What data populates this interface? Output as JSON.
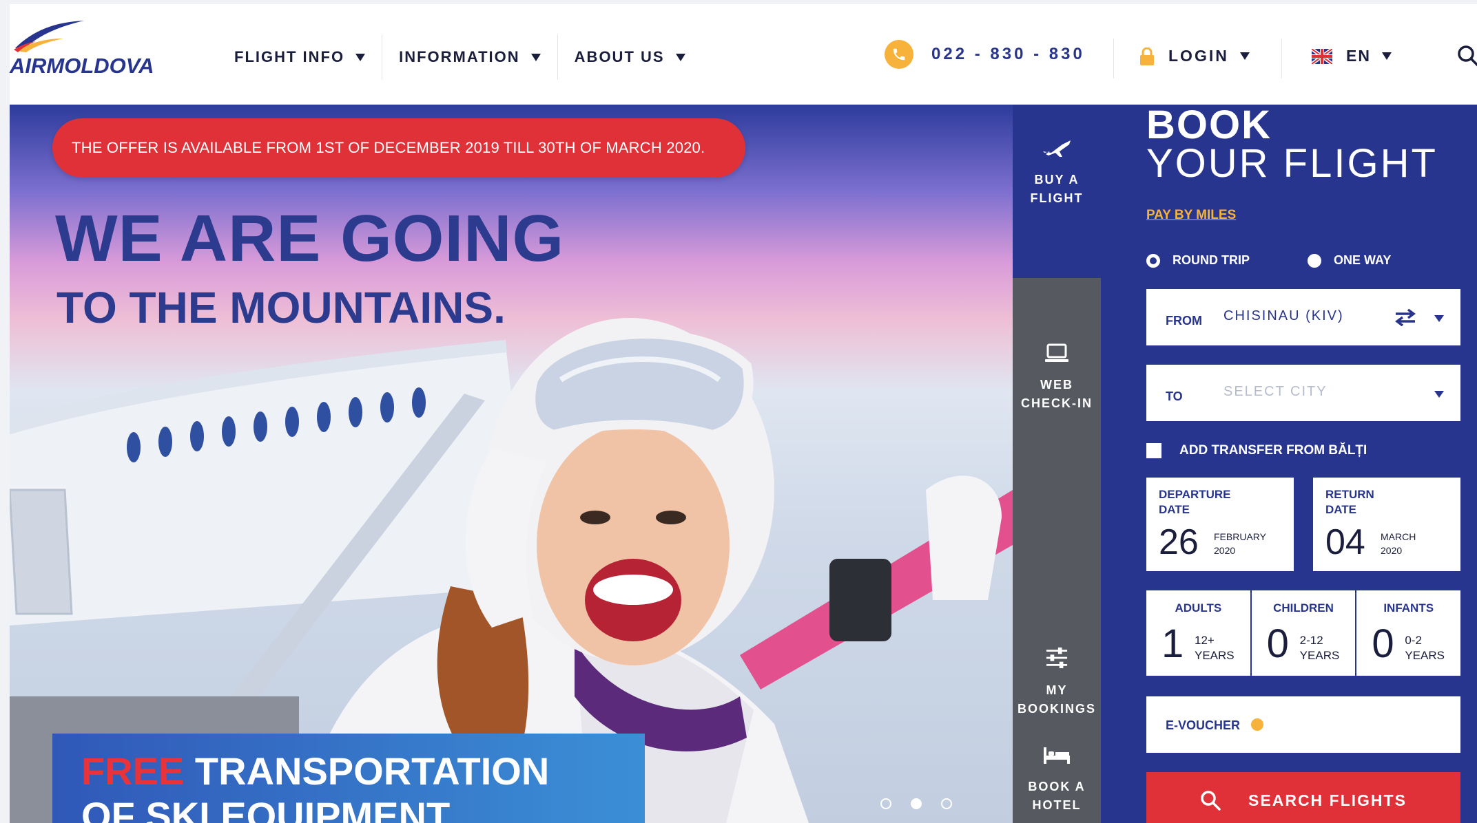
{
  "brand": {
    "name": "AIRMOLDOVA"
  },
  "nav": {
    "items": [
      {
        "label": "FLIGHT INFO"
      },
      {
        "label": "INFORMATION"
      },
      {
        "label": "ABOUT US"
      }
    ]
  },
  "header": {
    "phone": "022 - 830 - 830",
    "login_label": "LOGIN",
    "language": "EN"
  },
  "hero": {
    "offer": "THE OFFER IS AVAILABLE FROM 1ST OF DECEMBER 2019 TILL 30TH OF MARCH 2020.",
    "headline_1": "WE ARE GOING",
    "headline_2": "TO THE MOUNTAINS.",
    "promo_red": "FREE",
    "promo_rest": " TRANSPORTATION",
    "promo_line2": "OF SKI EQUIPMENT",
    "slides": 3,
    "active_slide": 2
  },
  "tabs": [
    {
      "label": "BUY A\nFLIGHT",
      "icon": "plane-icon"
    },
    {
      "label": "WEB\nCHECK-IN",
      "icon": "laptop-icon"
    },
    {
      "label": "MY\nBOOKINGS",
      "icon": "sliders-icon"
    },
    {
      "label": "BOOK A\nHOTEL",
      "icon": "bed-icon"
    }
  ],
  "booking": {
    "title_bold": "BOOK",
    "title_light": "YOUR FLIGHT",
    "pay_by_miles": "PAY BY MILES",
    "trip_types": [
      {
        "label": "ROUND TRIP",
        "selected": true
      },
      {
        "label": "ONE WAY",
        "selected": false
      }
    ],
    "from_label": "FROM",
    "from_value": "CHISINAU (KIV)",
    "to_label": "TO",
    "to_placeholder": "SELECT CITY",
    "transfer_label": "ADD TRANSFER FROM BĂLȚI",
    "transfer_checked": false,
    "departure": {
      "title": "DEPARTURE\nDATE",
      "day": "26",
      "month": "FEBRUARY",
      "year": "2020"
    },
    "return": {
      "title": "RETURN\nDATE",
      "day": "04",
      "month": "MARCH",
      "year": "2020"
    },
    "passengers": [
      {
        "title": "ADULTS",
        "count": "1",
        "age": "12+",
        "unit": "YEARS"
      },
      {
        "title": "CHILDREN",
        "count": "0",
        "age": "2-12",
        "unit": "YEARS"
      },
      {
        "title": "INFANTS",
        "count": "0",
        "age": "0-2",
        "unit": "YEARS"
      }
    ],
    "voucher_label": "E-VOUCHER",
    "search_label": "SEARCH FLIGHTS"
  },
  "colors": {
    "brand_blue": "#27358f",
    "accent_red": "#e03139",
    "accent_yellow": "#f6b23a"
  }
}
